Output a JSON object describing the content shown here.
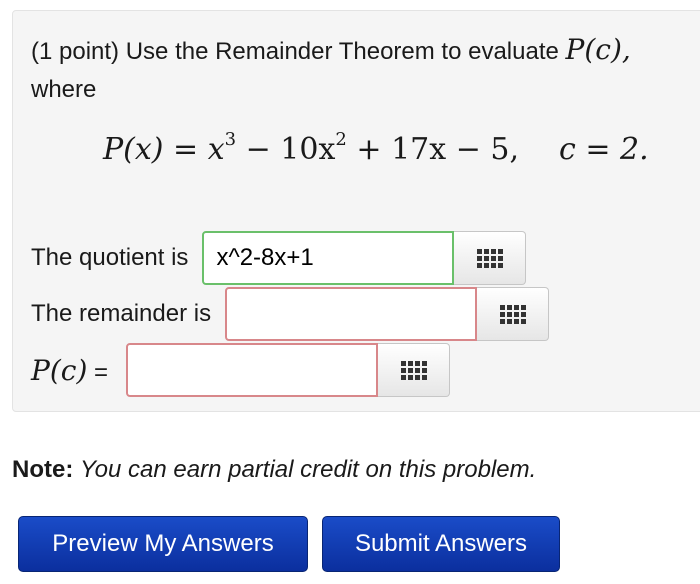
{
  "problem": {
    "points": "(1 point)",
    "instruction": "Use the Remainder Theorem to evaluate",
    "target": "P(c),",
    "where": "where",
    "equation": {
      "lhs": "P(x) = x",
      "exp1": "3",
      "mid1": " − 10x",
      "exp2": "2",
      "rest": " + 17x − 5,",
      "c_value": "c = 2."
    }
  },
  "answers": {
    "quotient_label": "The quotient is",
    "quotient_value": "x^2-8x+1",
    "remainder_label": "The remainder is",
    "remainder_value": "",
    "pc_label_func": "P(c)",
    "pc_label_eq": " =",
    "pc_value": ""
  },
  "note": {
    "label": "Note:",
    "text": "You can earn partial credit on this problem."
  },
  "buttons": {
    "preview": "Preview My Answers",
    "submit": "Submit Answers"
  },
  "icons": {
    "palette": "grid-icon"
  },
  "colors": {
    "correct_border": "#6ac06a",
    "incorrect_border": "#d8878a",
    "button_blue": "#0b2f9e"
  }
}
